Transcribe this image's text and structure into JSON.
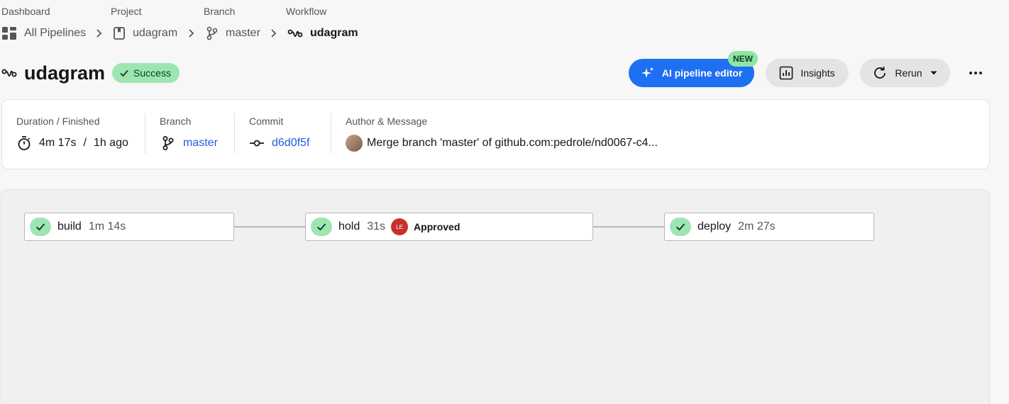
{
  "breadcrumb": {
    "labels": [
      "Dashboard",
      "Project",
      "Branch",
      "Workflow"
    ],
    "items": [
      {
        "text": "All Pipelines",
        "icon": "dashboard-grid-icon"
      },
      {
        "text": "udagram",
        "icon": "project-bookmark-icon"
      },
      {
        "text": "master",
        "icon": "branch-icon"
      },
      {
        "text": "udagram",
        "icon": "workflow-icon"
      }
    ]
  },
  "header": {
    "title": "udagram",
    "status": "Success",
    "ai_button": "AI pipeline editor",
    "new_badge": "NEW",
    "insights_button": "Insights",
    "rerun_button": "Rerun"
  },
  "info": {
    "duration_label": "Duration / Finished",
    "duration": "4m 17s",
    "separator": "/",
    "finished": "1h ago",
    "branch_label": "Branch",
    "branch": "master",
    "commit_label": "Commit",
    "commit": "d6d0f5f",
    "author_label": "Author & Message",
    "message": "Merge branch 'master' of github.com:pedrole/nd0067-c4..."
  },
  "jobs": [
    {
      "name": "build",
      "duration": "1m 14s"
    },
    {
      "name": "hold",
      "duration": "31s",
      "approver_initials": "LE",
      "approval": "Approved"
    },
    {
      "name": "deploy",
      "duration": "2m 27s"
    }
  ],
  "colors": {
    "accent": "#1f6ff2",
    "success": "#9de6b2",
    "link": "#1f5fd8",
    "approver": "#c9302c"
  }
}
